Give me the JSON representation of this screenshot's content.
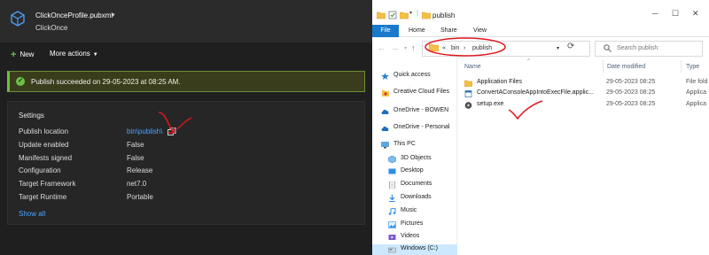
{
  "left": {
    "profile": {
      "name": "ClickOnceProfile.pubxml",
      "subtitle": "ClickOnce",
      "caret": "▾"
    },
    "toolbar": {
      "new_label": "New",
      "more_label": "More actions"
    },
    "success": {
      "message": "Publish succeeded on 29-05-2023 at 08:25 AM."
    },
    "settings": {
      "title": "Settings",
      "rows": [
        {
          "label": "Publish location",
          "value": "bin\\publish\\"
        },
        {
          "label": "Update enabled",
          "value": "False"
        },
        {
          "label": "Manifests signed",
          "value": "False"
        },
        {
          "label": "Configuration",
          "value": "Release"
        },
        {
          "label": "Target Framework",
          "value": "net7.0"
        },
        {
          "label": "Target Runtime",
          "value": "Portable"
        }
      ],
      "show_all": "Show all"
    }
  },
  "explorer": {
    "title": "publish",
    "tabs": {
      "file": "File",
      "home": "Home",
      "share": "Share",
      "view": "View"
    },
    "address": {
      "chevrons": "«",
      "segments": [
        "bin",
        "publish"
      ],
      "separator": "›"
    },
    "search_placeholder": "Search publish",
    "nav": [
      {
        "label": "Quick access",
        "icon": "star-icon"
      },
      {
        "label": "Creative Cloud Files",
        "icon": "creative-cloud-icon"
      },
      {
        "label": "OneDrive - BOWEN",
        "icon": "onedrive-icon"
      },
      {
        "label": "OneDrive - Personal",
        "icon": "onedrive-icon"
      },
      {
        "label": "This PC",
        "icon": "computer-icon"
      },
      {
        "label": "3D Objects",
        "icon": "3d-objects-icon"
      },
      {
        "label": "Desktop",
        "icon": "desktop-icon"
      },
      {
        "label": "Documents",
        "icon": "documents-icon"
      },
      {
        "label": "Downloads",
        "icon": "downloads-icon"
      },
      {
        "label": "Music",
        "icon": "music-icon"
      },
      {
        "label": "Pictures",
        "icon": "pictures-icon"
      },
      {
        "label": "Videos",
        "icon": "videos-icon"
      },
      {
        "label": "Windows (C:)",
        "icon": "drive-icon"
      }
    ],
    "columns": {
      "name": "Name",
      "date": "Date modified",
      "type": "Type"
    },
    "files": [
      {
        "name": "Application Files",
        "date": "29-05-2023 08:25",
        "type": "File fold",
        "icon": "folder-icon"
      },
      {
        "name": "ConvertAConsoleAppIntoExecFile.applic...",
        "date": "29-05-2023 08:25",
        "type": "Applica",
        "icon": "application-manifest-icon"
      },
      {
        "name": "setup.exe",
        "date": "29-05-2023 08:25",
        "type": "Applica",
        "icon": "setup-exe-icon"
      }
    ]
  },
  "colors": {
    "accent_blue": "#1979ca",
    "success_green": "#6cbf47",
    "annotation_red": "#e0161e",
    "link_blue": "#4aa3ff"
  }
}
